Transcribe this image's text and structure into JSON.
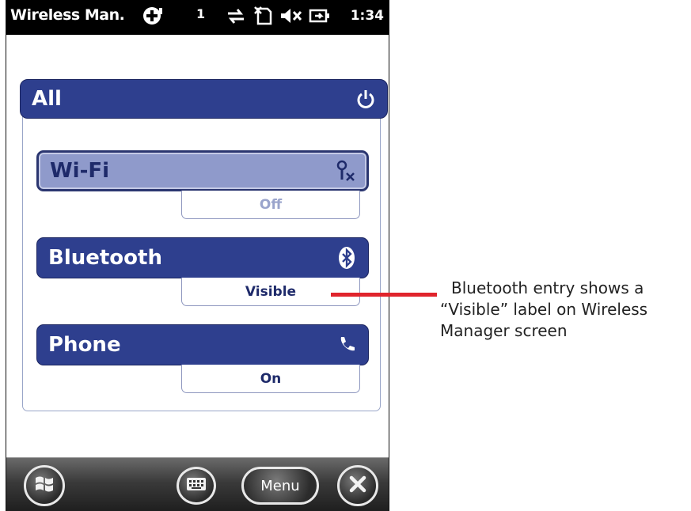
{
  "status_bar": {
    "title": "Wireless Man.",
    "signal_text": "1",
    "time": "1:34",
    "icons": [
      "connectivity-plus-icon",
      "data-arrows-icon",
      "no-sim-icon",
      "speaker-muted-icon",
      "battery-charging-icon"
    ]
  },
  "wireless_manager": {
    "all": {
      "label": "All",
      "icon": "power-icon"
    },
    "items": [
      {
        "label": "Wi-Fi",
        "icon": "wifi-antenna-off-icon",
        "status": "Off"
      },
      {
        "label": "Bluetooth",
        "icon": "bluetooth-icon",
        "status": "Visible"
      },
      {
        "label": "Phone",
        "icon": "phone-handset-icon",
        "status": "On"
      }
    ]
  },
  "softbar": {
    "menu_label": "Menu",
    "icons": [
      "windows-start-icon",
      "keyboard-icon",
      "close-icon"
    ]
  },
  "callout": {
    "lines": [
      "Bluetooth entry shows a",
      "“Visible” label on Wireless",
      "Manager screen"
    ],
    "line_color": "#e0242c"
  },
  "colors": {
    "bar_blue": "#2e3f8e",
    "wifi_selected": "#8f9acb",
    "status_text": "#1e2a6a"
  }
}
